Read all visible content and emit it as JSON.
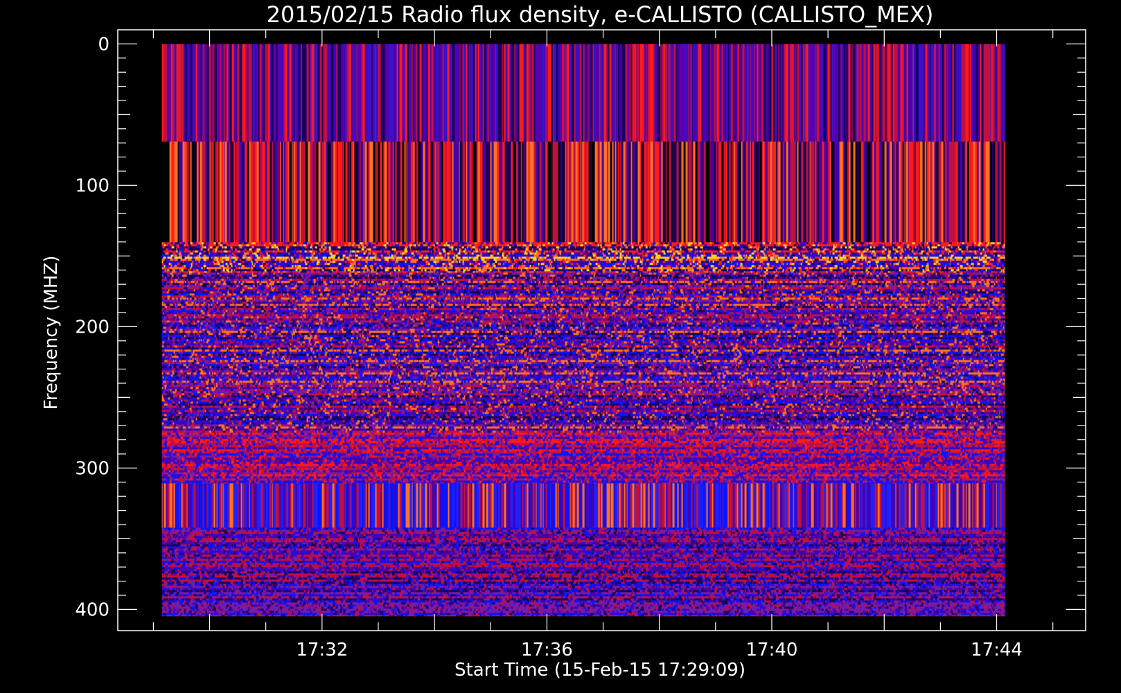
{
  "chart_data": {
    "type": "heatmap",
    "title": "2015/02/15  Radio flux density, e-CALLISTO (CALLISTO_MEX)",
    "xlabel": "Start Time (15-Feb-15 17:29:09)",
    "ylabel": "Frequency (MHZ)",
    "x_axis": {
      "unit": "time",
      "range": [
        "17:29:09",
        "17:44:09"
      ],
      "view_range": [
        "17:28:22",
        "17:45:35"
      ],
      "tick_labels": [
        "17:32",
        "17:36",
        "17:40",
        "17:44"
      ],
      "major_tick_times": [
        "17:30",
        "17:32",
        "17:34",
        "17:36",
        "17:38",
        "17:40",
        "17:42",
        "17:44"
      ],
      "minor_tick_step_minutes": 1
    },
    "y_axis": {
      "unit": "MHz",
      "range": [
        0,
        405
      ],
      "view_range": [
        -10,
        415
      ],
      "inverted": true,
      "tick_labels": [
        "0",
        "100",
        "200",
        "300",
        "400"
      ],
      "major_tick_values": [
        0,
        100,
        200,
        300,
        400
      ],
      "minor_tick_step": 10,
      "medium_tick_step": 50
    },
    "colormap": [
      "#000000",
      "#1a0060",
      "#4a00a8",
      "#0a14ff",
      "#7a1aa0",
      "#c01040",
      "#ff1a1a",
      "#ff7020",
      "#ffd020",
      "#ffffff"
    ],
    "bands": [
      {
        "freq_range": [
          0,
          69
        ],
        "pattern": "vertical-stripes",
        "mean_intensity": 0.45,
        "palette": [
          "#5a00b0",
          "#4a00a8",
          "#c01040",
          "#ff1a1a",
          "#1a0060",
          "#3a10c8"
        ]
      },
      {
        "freq_range": [
          69,
          140
        ],
        "pattern": "vertical-stripes",
        "mean_intensity": 0.55,
        "palette": [
          "#ff1a1a",
          "#c01040",
          "#1a0060",
          "#000000",
          "#4a00a8",
          "#ff7020"
        ]
      },
      {
        "freq_range": [
          140,
          162
        ],
        "pattern": "noisy",
        "mean_intensity": 0.6,
        "palette": [
          "#ff7020",
          "#ff1a1a",
          "#1a0060",
          "#0a14ff",
          "#ffd020",
          "#4a00a8"
        ]
      },
      {
        "freq_range": [
          162,
          275
        ],
        "pattern": "noisy",
        "mean_intensity": 0.4,
        "palette": [
          "#4a00a8",
          "#0a14ff",
          "#7a1aa0",
          "#c01040",
          "#1a0060",
          "#ff7020"
        ]
      },
      {
        "freq_range": [
          275,
          311
        ],
        "pattern": "noisy",
        "mean_intensity": 0.42,
        "palette": [
          "#0a14ff",
          "#4a00a8",
          "#c01040",
          "#7a1aa0",
          "#ff1a1a"
        ]
      },
      {
        "freq_range": [
          311,
          342
        ],
        "pattern": "vertical-stripes",
        "mean_intensity": 0.35,
        "palette": [
          "#0a14ff",
          "#1e20ff",
          "#4a00a8",
          "#c01040",
          "#ff7020"
        ]
      },
      {
        "freq_range": [
          342,
          405
        ],
        "pattern": "noisy",
        "mean_intensity": 0.4,
        "palette": [
          "#4a00a8",
          "#0a14ff",
          "#7a1aa0",
          "#c01040",
          "#1a0060"
        ]
      }
    ],
    "grid": false,
    "legend": "none"
  }
}
